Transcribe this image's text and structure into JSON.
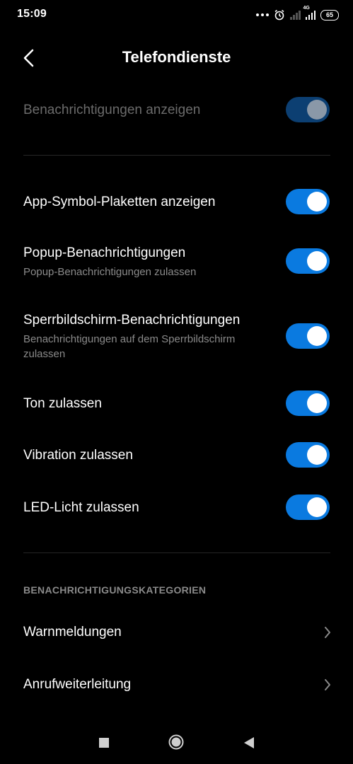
{
  "status_bar": {
    "time": "15:09",
    "network": "4G",
    "battery": "65"
  },
  "header": {
    "title": "Telefondienste"
  },
  "main_toggle": {
    "label": "Benachrichtigungen anzeigen"
  },
  "settings": [
    {
      "label": "App-Symbol-Plaketten anzeigen",
      "enabled": true
    },
    {
      "label": "Popup-Benachrichtigungen",
      "sub": "Popup-Benachrichtigungen zulassen",
      "enabled": true
    },
    {
      "label": "Sperrbildschirm-Benachrichtigungen",
      "sub": "Benachrichtigungen auf dem Sperrbildschirm zulassen",
      "enabled": true
    },
    {
      "label": "Ton zulassen",
      "enabled": true
    },
    {
      "label": "Vibration zulassen",
      "enabled": true
    },
    {
      "label": "LED-Licht zulassen",
      "enabled": true
    }
  ],
  "categories": {
    "heading": "BENACHRICHTIGUNGSKATEGORIEN",
    "items": [
      {
        "label": "Warnmeldungen"
      },
      {
        "label": "Anrufweiterleitung"
      }
    ]
  },
  "colors": {
    "accent": "#0a7ae0",
    "background": "#000000"
  }
}
